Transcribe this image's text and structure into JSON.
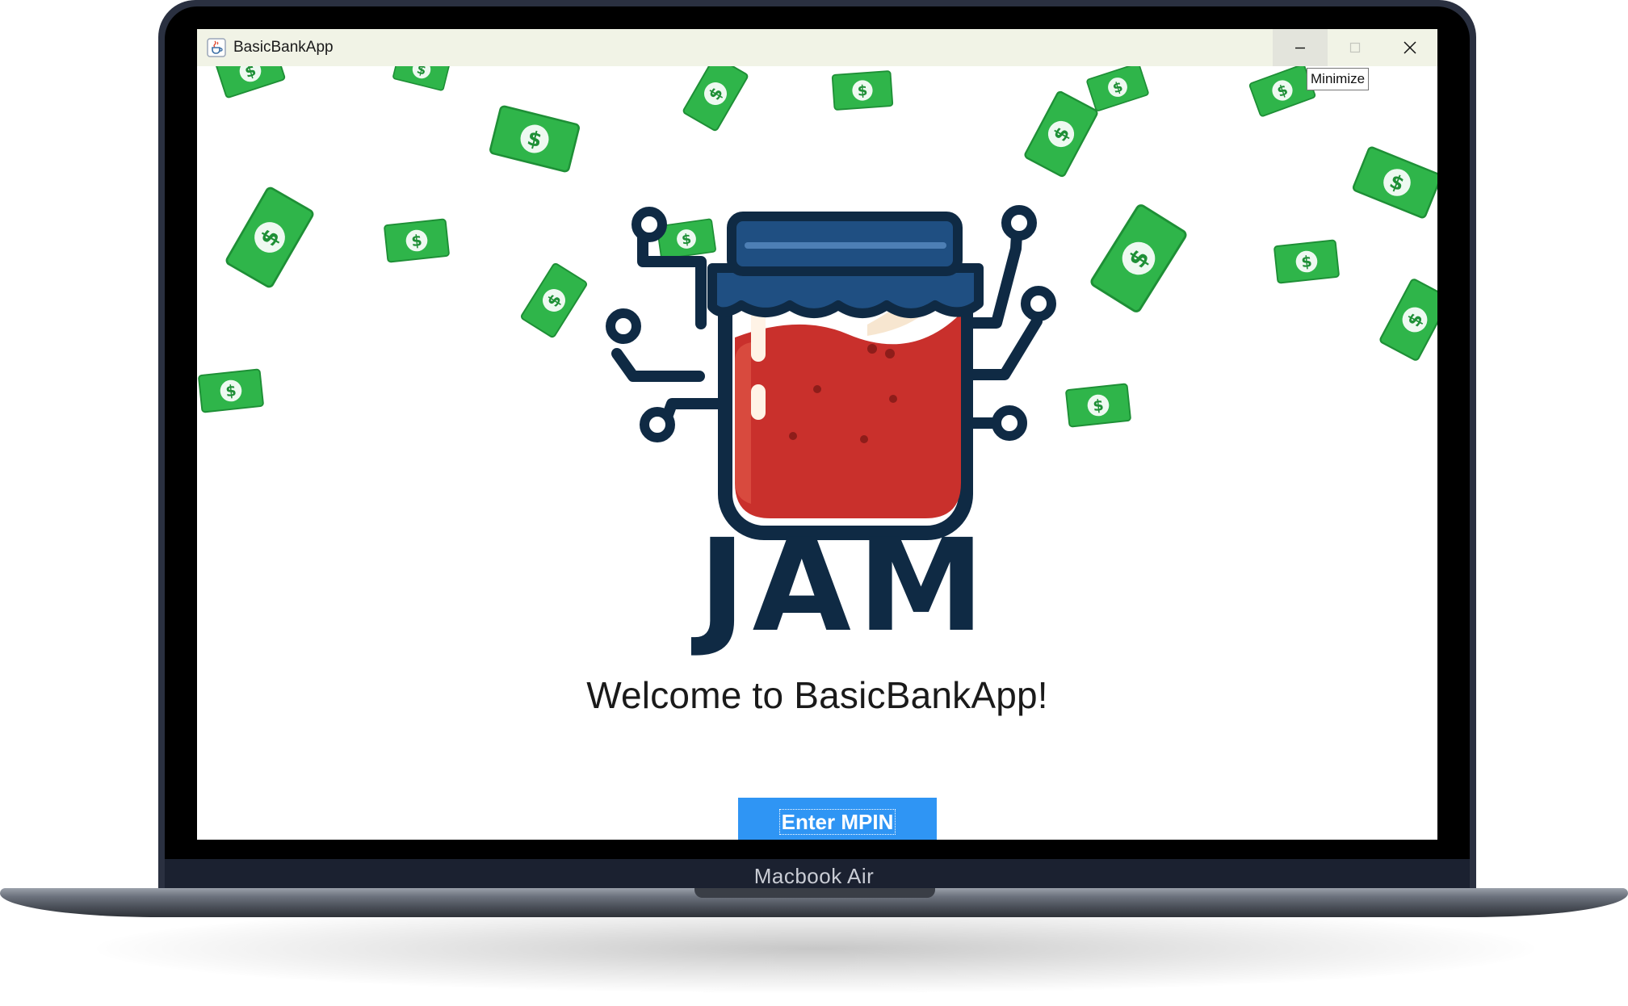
{
  "device": {
    "label": "Macbook Air"
  },
  "window": {
    "title": "BasicBankApp",
    "app_icon": "java-cup-icon",
    "controls": {
      "minimize_icon": "minimize-icon",
      "maximize_icon": "maximize-icon",
      "close_icon": "close-icon"
    },
    "tooltip": "Minimize"
  },
  "main": {
    "logo_text": "JAM",
    "welcome_text": "Welcome to BasicBankApp!",
    "enter_mpin_label": "Enter MPIN"
  },
  "colors": {
    "titlebar": "#f1f3e6",
    "button_bg": "#2f95f4",
    "logo_navy": "#0f2a44",
    "jam_red": "#c9302c",
    "bill_green": "#2fb54a"
  }
}
